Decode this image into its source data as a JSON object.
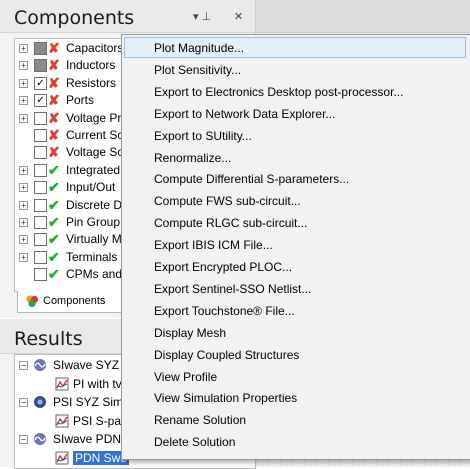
{
  "components_pane": {
    "title": "Components",
    "pin_icon": "pin-icon",
    "close_icon": "close-icon",
    "tab_label": "Components",
    "items": [
      {
        "label": "Capacitors",
        "checkbox": "partial",
        "status": "x",
        "expandable": true
      },
      {
        "label": "Inductors",
        "checkbox": "partial",
        "status": "x",
        "expandable": true
      },
      {
        "label": "Resistors",
        "checkbox": "checked",
        "status": "x",
        "expandable": true
      },
      {
        "label": "Ports",
        "checkbox": "checked",
        "status": "x",
        "expandable": true
      },
      {
        "label": "Voltage Pr",
        "checkbox": "empty",
        "status": "x",
        "expandable": true
      },
      {
        "label": "Current Sc",
        "checkbox": "empty",
        "status": "x",
        "expandable": false
      },
      {
        "label": "Voltage Sc",
        "checkbox": "empty",
        "status": "x",
        "expandable": false
      },
      {
        "label": "Integrated",
        "checkbox": "empty",
        "status": "ok",
        "expandable": true
      },
      {
        "label": "Input/Out",
        "checkbox": "empty",
        "status": "ok",
        "expandable": true
      },
      {
        "label": "Discrete D",
        "checkbox": "empty",
        "status": "ok",
        "expandable": true
      },
      {
        "label": "Pin Group",
        "checkbox": "empty",
        "status": "ok",
        "expandable": true
      },
      {
        "label": "Virtually M",
        "checkbox": "empty",
        "status": "ok",
        "expandable": true
      },
      {
        "label": "Terminals",
        "checkbox": "empty",
        "status": "ok",
        "expandable": true
      },
      {
        "label": "CPMs and",
        "checkbox": "empty",
        "status": "ok",
        "expandable": false
      }
    ]
  },
  "results_pane": {
    "title": "Results",
    "items": [
      {
        "label": "SIwave SYZ S",
        "icon": "siwave-icon",
        "level": 0,
        "expander": "−"
      },
      {
        "label": "PI with tv",
        "icon": "sparam-plot-icon",
        "level": 1,
        "expander": ""
      },
      {
        "label": "PSI SYZ Simu",
        "icon": "psi-icon",
        "level": 0,
        "expander": "−"
      },
      {
        "label": "PSI S-par",
        "icon": "sparam-plot-icon",
        "level": 1,
        "expander": ""
      },
      {
        "label": "SIwave PDN",
        "icon": "siwave-icon",
        "level": 0,
        "expander": "−"
      },
      {
        "label": "PDN Swe",
        "icon": "sparam-plot-icon",
        "level": 1,
        "expander": "",
        "selected": true
      }
    ]
  },
  "context_menu": {
    "items": [
      {
        "label": "Plot Magnitude...",
        "highlighted": true
      },
      {
        "label": "Plot Sensitivity..."
      },
      {
        "label": "Export to Electronics Desktop post-processor..."
      },
      {
        "label": "Export to Network Data Explorer..."
      },
      {
        "label": "Export to SUtility..."
      },
      {
        "label": "Renormalize..."
      },
      {
        "label": "Compute Differential S-parameters..."
      },
      {
        "label": "Compute FWS sub-circuit..."
      },
      {
        "label": "Compute RLGC sub-circuit..."
      },
      {
        "label": "Export IBIS ICM File..."
      },
      {
        "label": "Export Encrypted PLOC..."
      },
      {
        "label": "Export Sentinel-SSO Netlist..."
      },
      {
        "label": "Export Touchstone® File..."
      },
      {
        "label": "Display Mesh"
      },
      {
        "label": "Display Coupled Structures"
      },
      {
        "label": "View Profile"
      },
      {
        "label": "View Simulation Properties"
      },
      {
        "label": "Rename Solution"
      },
      {
        "label": "Delete Solution"
      }
    ]
  },
  "colors": {
    "status_x": "#e23b2c",
    "status_ok": "#1cae2c",
    "menu_highlight": "#e5effa",
    "selection": "#2f73d9"
  }
}
